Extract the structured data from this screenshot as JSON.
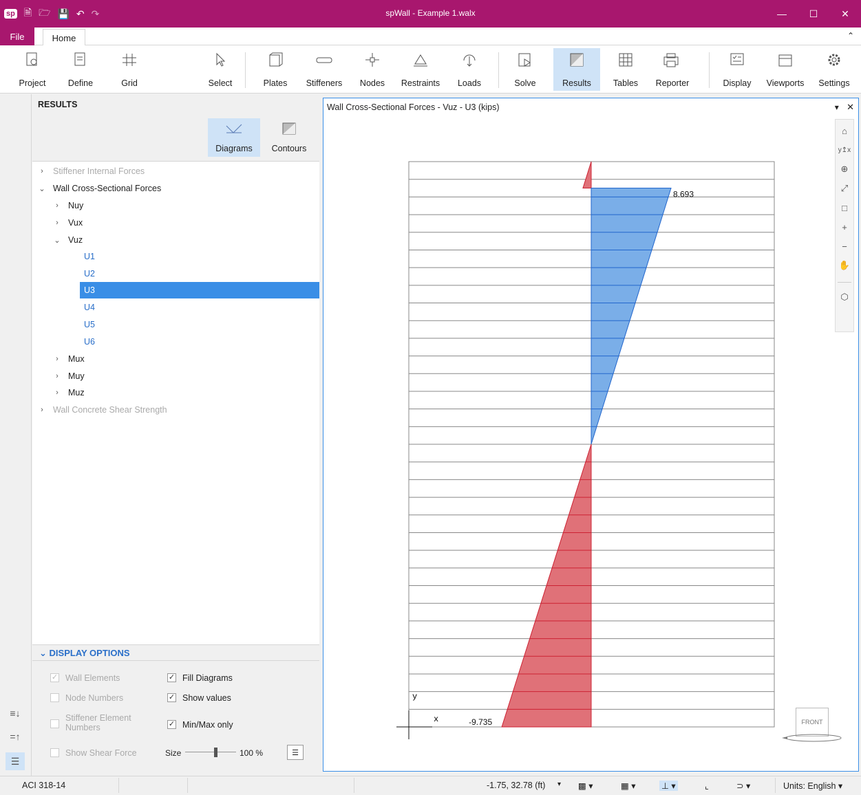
{
  "app": {
    "title": "spWall - Example 1.walx",
    "logo": "sp"
  },
  "ribbon_tabs": {
    "file": "File",
    "home": "Home"
  },
  "ribbon": {
    "project": "Project",
    "define": "Define",
    "grid": "Grid",
    "select": "Select",
    "plates": "Plates",
    "stiffeners": "Stiffeners",
    "nodes": "Nodes",
    "restraints": "Restraints",
    "loads": "Loads",
    "solve": "Solve",
    "results": "Results",
    "tables": "Tables",
    "reporter": "Reporter",
    "display": "Display",
    "viewports": "Viewports",
    "settings": "Settings"
  },
  "results_panel": {
    "header": "RESULTS",
    "diagrams": "Diagrams",
    "contours": "Contours",
    "tree": {
      "stiffener": "Stiffener Internal Forces",
      "wall": "Wall Cross-Sectional Forces",
      "nuy": "Nuy",
      "vux": "Vux",
      "vuz": "Vuz",
      "u1": "U1",
      "u2": "U2",
      "u3": "U3",
      "u4": "U4",
      "u5": "U5",
      "u6": "U6",
      "mux": "Mux",
      "muy": "Muy",
      "muz": "Muz",
      "shear": "Wall Concrete Shear Strength"
    }
  },
  "display_options": {
    "title": "DISPLAY OPTIONS",
    "wall_elements": "Wall Elements",
    "node_numbers": "Node Numbers",
    "stiffener_element_numbers": "Stiffener Element Numbers",
    "show_shear_force": "Show Shear Force",
    "fill_diagrams": "Fill Diagrams",
    "show_values": "Show values",
    "minmax_only": "Min/Max only",
    "size_label": "Size",
    "size_value": "100 %",
    "size_fraction": 0.6
  },
  "view": {
    "title": "Wall Cross-Sectional Forces - Vuz - U3 (kips)",
    "max_label": "8.693",
    "min_label": "-9.735",
    "axis_y": "y",
    "axis_x": "x",
    "cube_label": "FRONT",
    "colors": {
      "positive": "#7aaee8",
      "negative": "#e07178",
      "pos_line": "#2266cc",
      "neg_line": "#cc2233"
    }
  },
  "chart_data": {
    "type": "area",
    "segments": 32,
    "positive_end_value": 8.693,
    "negative_end_value": -9.735,
    "top_spike_value": -0.9
  },
  "statusbar": {
    "code": "ACI 318-14",
    "coords": "-1.75, 32.78 (ft)",
    "units": "Units:  English"
  }
}
